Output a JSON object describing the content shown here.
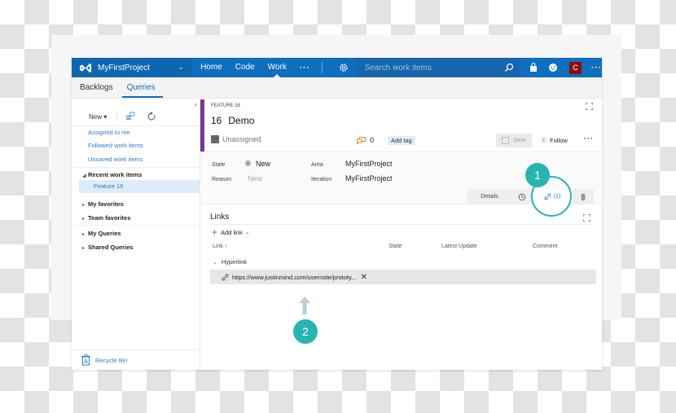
{
  "topbar": {
    "project_name": "MyFirstProject",
    "nav": [
      "Home",
      "Code",
      "Work"
    ],
    "nav_active": "Work",
    "search_placeholder": "Search work items",
    "avatar_initial": "C"
  },
  "subnav": {
    "tabs": [
      "Backlogs",
      "Queries"
    ],
    "active": "Queries"
  },
  "sidebar": {
    "new_label": "New",
    "links": [
      "Assigned to me",
      "Followed work items",
      "Unsaved work items"
    ],
    "groups": [
      "Recent work items",
      "My favorites",
      "Team favorites",
      "My Queries",
      "Shared Queries"
    ],
    "selected_item": "Feature 16",
    "recycle_bin": "Recycle Bin"
  },
  "work_item": {
    "type_label": "FEATURE 16",
    "id": "16",
    "title": "Demo",
    "assignee": "Unassigned",
    "comment_count": "0",
    "add_tag": "Add tag",
    "save_label": "Save",
    "follow_label": "Follow",
    "colors": {
      "feature": "#773b93",
      "accent": "#106ebe",
      "annotation": "#27b5b1"
    },
    "fields": {
      "state_label": "State",
      "state_value": "New",
      "reason_label": "Reason",
      "reason_value": "New",
      "area_label": "Area",
      "area_value": "MyFirstProject",
      "iteration_label": "Iteration",
      "iteration_value": "MyFirstProject"
    },
    "tabs": {
      "details": "Details",
      "links": "(1)"
    }
  },
  "links": {
    "title": "Links",
    "add_link": "Add link",
    "columns": [
      "Link",
      "State",
      "Latest Update",
      "Comment"
    ],
    "group": "Hyperlink",
    "items": [
      {
        "url": "https://www.justinmind.com/usernote/prototy..."
      }
    ]
  },
  "annotations": {
    "step1": "1",
    "step2": "2"
  }
}
